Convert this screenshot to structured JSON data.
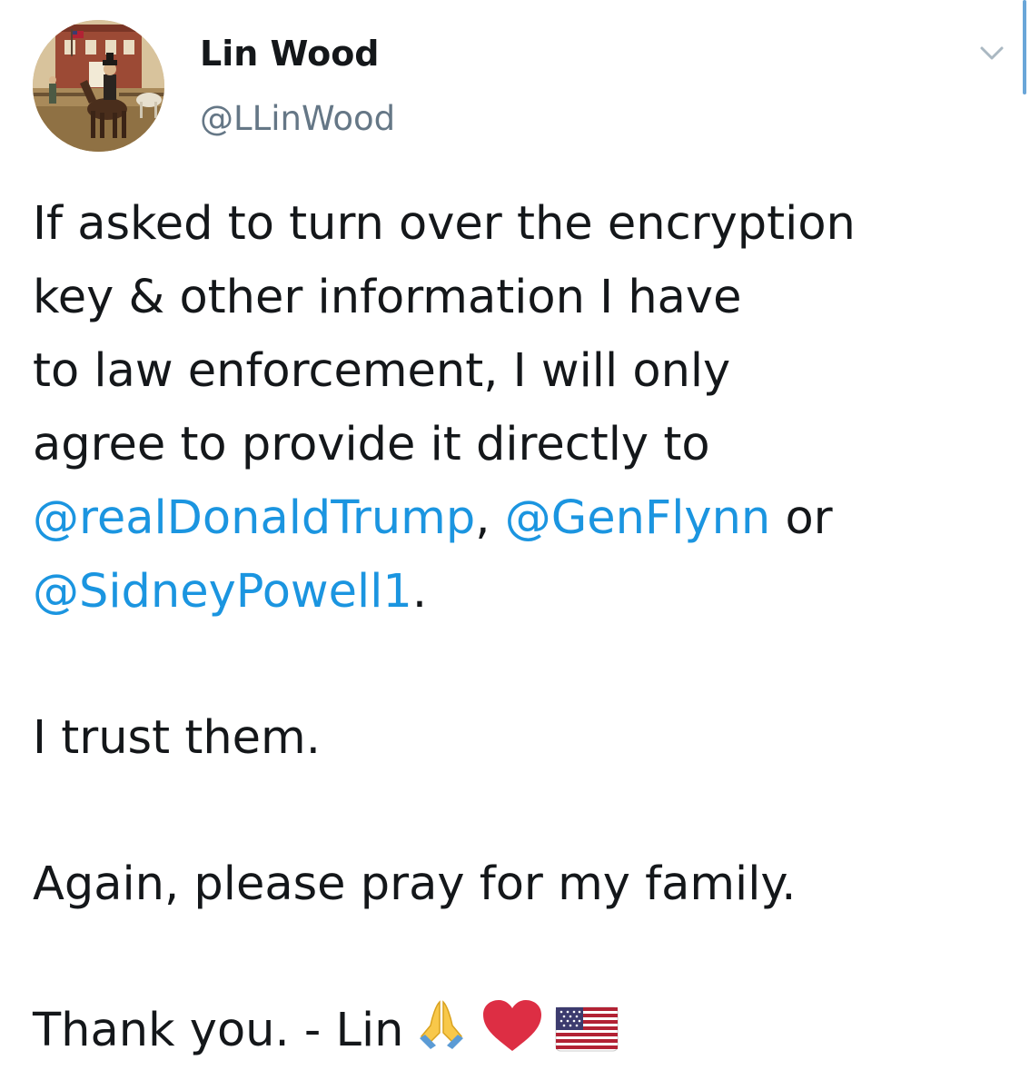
{
  "author": {
    "display_name": "Lin Wood",
    "handle": "@LLinWood",
    "avatar_icon": "profile-painting-horse-rider"
  },
  "menu": {
    "icon": "chevron-down-icon"
  },
  "tweet": {
    "para1": {
      "line1": "If asked to turn over the encryption",
      "line2": "key & other information I have",
      "line3": "to law enforcement, I will only",
      "line4": "agree to provide it directly to",
      "mention1": "@realDonaldTrump",
      "comma": ",",
      "mention2": "@GenFlynn",
      "or": "or",
      "mention3": "@SidneyPowell1",
      "period": "."
    },
    "para2": "I trust them.",
    "para3": "Again, please pray for my family.",
    "para4": "Thank you. - Lin",
    "emojis": [
      "folded-hands-icon",
      "red-heart-icon",
      "us-flag-icon"
    ]
  },
  "colors": {
    "mention": "#1b95e0",
    "handle": "#657786",
    "text": "#14171a"
  }
}
